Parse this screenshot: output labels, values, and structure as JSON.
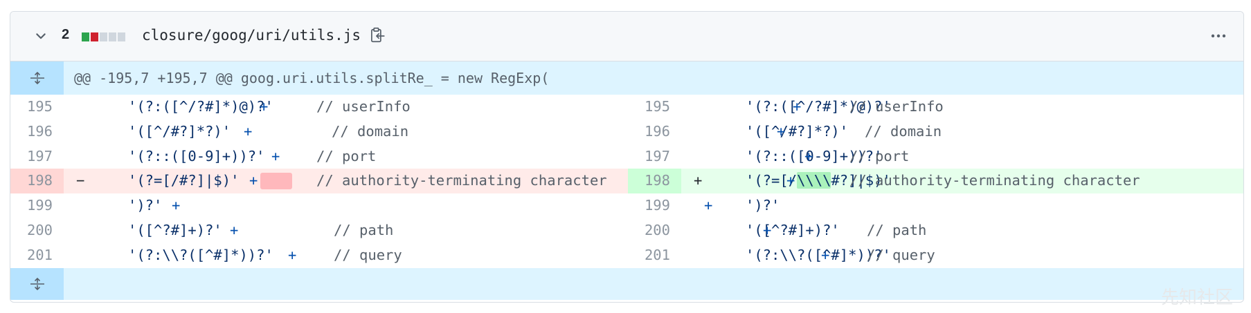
{
  "file": {
    "change_count": "2",
    "path": "closure/goog/uri/utils.js",
    "diffstat": [
      "#2da44e",
      "#cf222e",
      "#d0d7de",
      "#d0d7de",
      "#d0d7de"
    ]
  },
  "hunk": {
    "header": "@@ -195,7 +195,7 @@ goog.uri.utils.splitRe_ = new RegExp("
  },
  "rows": [
    {
      "left_num": "195",
      "left_code": "'(?:([^/?#]*)@)?'",
      "left_plus": "+",
      "left_comment": "// userInfo",
      "right_num": "195",
      "right_code": "'(?:([^/?#]*)@)?'",
      "right_plus": "+",
      "right_comment": "// userInfo"
    },
    {
      "left_num": "196",
      "left_code": "'([^/#?]*?)'",
      "left_plus": "+",
      "left_comment": "// domain",
      "right_num": "196",
      "right_code": "'([^/#?]*?)'",
      "right_plus": "+",
      "right_comment": "// domain"
    },
    {
      "left_num": "197",
      "left_code": "'(?::([0-9]+))?'",
      "left_plus": "+",
      "left_comment": "// port",
      "right_num": "197",
      "right_code": "'(?::([0-9]+))?'",
      "right_plus": "+",
      "right_comment": "// port"
    },
    {
      "left_num": "198",
      "left_marker": "−",
      "left_code": "'(?=[/#?]|$)'",
      "left_plus": "+",
      "left_comment": "// authority-terminating character",
      "right_num": "198",
      "right_marker": "+",
      "right_code_a": "'(?=[/",
      "right_code_hl": "\\\\\\\\",
      "right_code_b": "#?]|$)'",
      "right_plus": "+",
      "right_comment": "// authority-terminating character"
    },
    {
      "left_num": "199",
      "left_code": "')?'",
      "left_plus": "+",
      "left_comment": "",
      "right_num": "199",
      "right_code": "')?'",
      "right_plus": "+",
      "right_comment": ""
    },
    {
      "left_num": "200",
      "left_code": "'([^?#]+)?'",
      "left_plus": "+",
      "left_comment": "// path",
      "right_num": "200",
      "right_code": "'([^?#]+)?'",
      "right_plus": "+",
      "right_comment": "// path"
    },
    {
      "left_num": "201",
      "left_code": "'(?:\\\\?([^#]*))?'",
      "left_plus": "+",
      "left_comment": "// query",
      "right_num": "201",
      "right_code": "'(?:\\\\?([^#]*))?'",
      "right_plus": "+",
      "right_comment": "// query"
    }
  ],
  "icons": {
    "collapse": "chevron-down-icon",
    "copy": "copy-clipboard-icon",
    "menu": "kebab-horizontal-icon",
    "expand_up": "unfold-icon",
    "expand_down": "unfold-icon"
  },
  "watermark": "先知社区"
}
